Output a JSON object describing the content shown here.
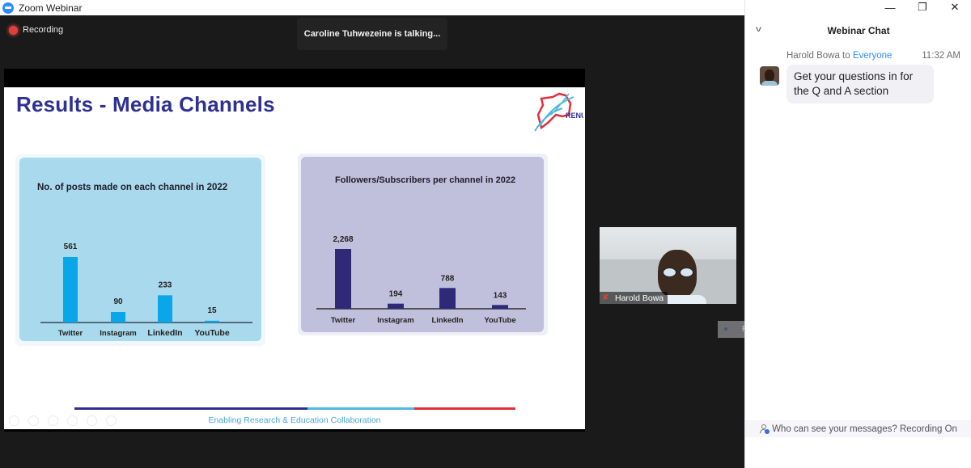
{
  "window": {
    "title": "Zoom Webinar",
    "controls": {
      "minimize": "—",
      "restore": "❐",
      "close": "✕"
    }
  },
  "meeting": {
    "recording_label": "Recording",
    "talking_indicator": "Caroline Tuhwezeine is talking..."
  },
  "slide": {
    "title": "Results - Media Channels",
    "logo_text": "RENU",
    "footer_text": "Enabling Research & Education Collaboration",
    "footer_colors": [
      "#2e3192",
      "#4fb8e0",
      "#e0303a"
    ]
  },
  "chart_data": [
    {
      "type": "bar",
      "title": "No. of posts made on each channel in 2022",
      "categories": [
        "Twitter",
        "Instagram",
        "LinkedIn",
        "YouTube"
      ],
      "values": [
        561,
        90,
        233,
        15
      ],
      "value_labels": [
        "561",
        "90",
        "233",
        "15"
      ],
      "color": "#0aa6ea",
      "xlabel": "",
      "ylabel": "",
      "grid": false
    },
    {
      "type": "bar",
      "title": "Followers/Subscribers per channel in 2022",
      "categories": [
        "Twitter",
        "Instagram",
        "LinkedIn",
        "YouTube"
      ],
      "values": [
        2268,
        194,
        788,
        143
      ],
      "value_labels": [
        "2,268",
        "194",
        "788",
        "143"
      ],
      "color": "#2f2a78",
      "xlabel": "",
      "ylabel": "",
      "grid": false
    }
  ],
  "video": {
    "participant_name": "Harold Bowa",
    "muted": true
  },
  "overlay": {
    "snip_label": "Rectangular Snip"
  },
  "chat": {
    "title": "Webinar Chat",
    "messages": [
      {
        "sender": "Harold Bowa",
        "to_word": "to",
        "recipient": "Everyone",
        "time": "11:32 AM",
        "text": "Get your questions in for the Q and A section"
      }
    ],
    "privacy_notice": "Who can see your messages? Recording On"
  }
}
